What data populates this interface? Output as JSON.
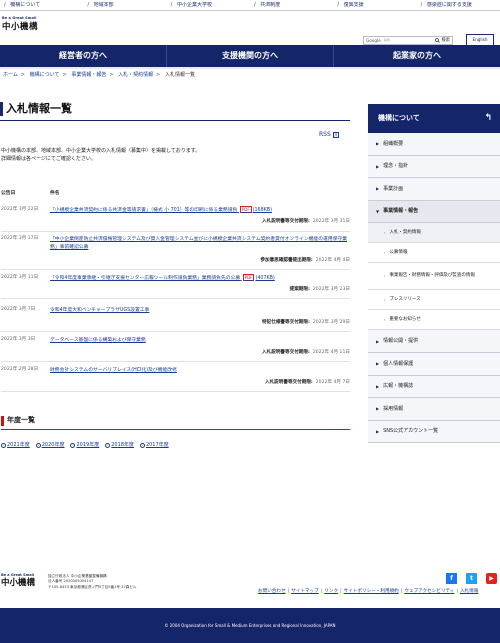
{
  "topbar": [
    "機構について",
    "地域本部",
    "中小企業大学校",
    "共済制度",
    "復興支援",
    "感染症に関する支援"
  ],
  "logo": {
    "tagline": "Be a Great Small",
    "name": "中小機構"
  },
  "search": {
    "google": "Google",
    "placeholder": "提供",
    "button": "検索"
  },
  "english": "English",
  "nav": [
    "経営者の方へ",
    "支援機関の方へ",
    "起業家の方へ"
  ],
  "breadcrumb": [
    "ホーム",
    "機構について",
    "事業情報・報告",
    "入札・契約情報",
    "入札情報一覧"
  ],
  "page_title": "入札情報一覧",
  "rss": "RSS",
  "intro": [
    "中小機構の本部、地域本部、中小企業大学校の入札情報（募集中）を掲載しております。",
    "詳細情報は各ページにてご確認ください。"
  ],
  "table_header": {
    "date": "公告日",
    "item": "件名"
  },
  "entries": [
    {
      "date": "2022年 3月 22日",
      "title": "「小規模企業共済契約に係る共済金等請求書」（様式 小 701）等の印刷に係る業務請負",
      "pdf": "PDF",
      "size": "(168KB)",
      "deadline_label": "入札説明書等交付期限:",
      "deadline": "2022年 3月 31日"
    },
    {
      "date": "2022年 3月 17日",
      "title": "「中小企業倒産防止共済債権管理システム及び資入金管理システム並びに小規模企業共済システム契約者貸付オンライン機能の運用保守業務」事前確認公募",
      "pdf": "",
      "size": "",
      "deadline_label": "参加意思確認書提出期限:",
      "deadline": "2022年 4月 4日"
    },
    {
      "date": "2022年 3月 11日",
      "title": "「令和4年度事業承継・引継ぎ支援センター広報ツール制作請負業務」業務請負先の公募",
      "pdf": "PDF",
      "size": "(407KB)",
      "deadline_label": "提案期限:",
      "deadline": "2022年 3月 23日"
    },
    {
      "date": "2022年 3月 7日",
      "title": "令和4年度大和ベンチャープラザUGS設置工事",
      "pdf": "",
      "size": "",
      "deadline_label": "特記仕様書等交付期限:",
      "deadline": "2022年 3月 29日"
    },
    {
      "date": "2022年 3月 3日",
      "title": "データベース基盤に係る構築および保守業務",
      "pdf": "",
      "size": "",
      "deadline_label": "入札説明書等交付期限:",
      "deadline": "2022年 4月 11日"
    },
    {
      "date": "2022年 2月 28日",
      "title": "財務会計システムのサーバリプレイス(HCI化)及び機能改修",
      "pdf": "",
      "size": "",
      "deadline_label": "入札説明書等交付期限:",
      "deadline": "2022年 4月 7日"
    }
  ],
  "nendo_title": "年度一覧",
  "years": [
    "2021年度",
    "2020年度",
    "2019年度",
    "2018年度",
    "2017年度"
  ],
  "sidebar": {
    "title": "機構について",
    "items": [
      "組織概要",
      "理念・指針",
      "事業計画",
      "事業情報・報告"
    ],
    "subitems": [
      "入札・契約情報",
      "公募情報",
      "事業報告・財務情報・評価及び監査の情報",
      "プレスリリース",
      "重要なお知らせ"
    ],
    "items2": [
      "情報公開・提供",
      "個人情報保護",
      "広報・機構誌",
      "採用情報",
      "SNS公式アカウント一覧"
    ]
  },
  "footer": {
    "org": [
      "独立行政法人 中小企業基盤整備機構",
      "法人番号 2020005004147",
      "〒105-8453 東京都港区虎ノ門3丁目5番1号 37森ビル"
    ],
    "links": [
      "お問い合わせ",
      "サイトマップ",
      "リンク",
      "サイトポリシー・利用規約",
      "ウェブアクセシビリティ",
      "入札情報"
    ],
    "copyright": "© 2004 Organization for Small & Medium Enterprises and Regional Innovation, JAPAN"
  },
  "colors": {
    "navy": "#15256a",
    "link": "#1a3b8f",
    "accent_red": "#c11"
  }
}
